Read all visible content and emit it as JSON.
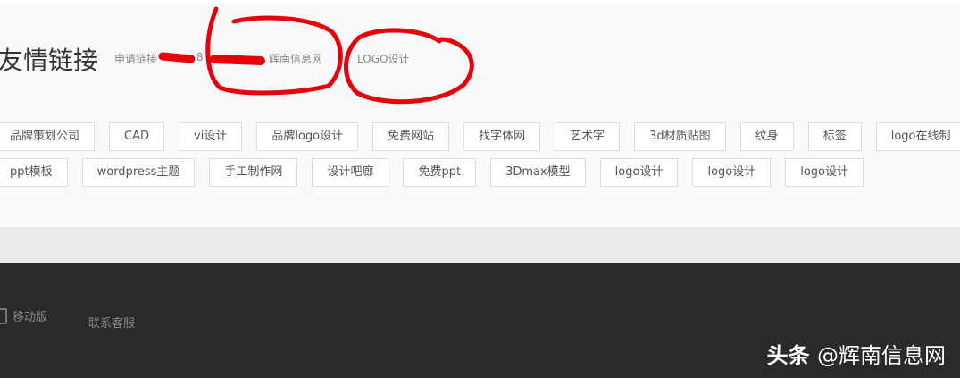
{
  "friend_links": {
    "title": "友情链接",
    "apply_label": "申请链接",
    "qq_partial": "8",
    "site_links": [
      "辉南信息网",
      "LOGO设计"
    ],
    "tags_row1": [
      "品牌策划公司",
      "CAD",
      "vi设计",
      "品牌logo设计",
      "免费网站",
      "找字体网",
      "艺术字",
      "3d材质贴图",
      "纹身",
      "标签",
      "logo在线制"
    ],
    "tags_row2": [
      "ppt模板",
      "wordpress主题",
      "手工制作网",
      "设计吧廊",
      "免费ppt",
      "3Dmax模型",
      "logo设计",
      "logo设计",
      "logo设计"
    ]
  },
  "footer": {
    "mobile_label": "移动版",
    "service_label": "联系客服"
  },
  "watermark": {
    "brand": "头条",
    "handle": "@辉南信息网"
  },
  "colors": {
    "annotation_red": "#e8000b",
    "footer_bg": "#2a2a2a"
  }
}
